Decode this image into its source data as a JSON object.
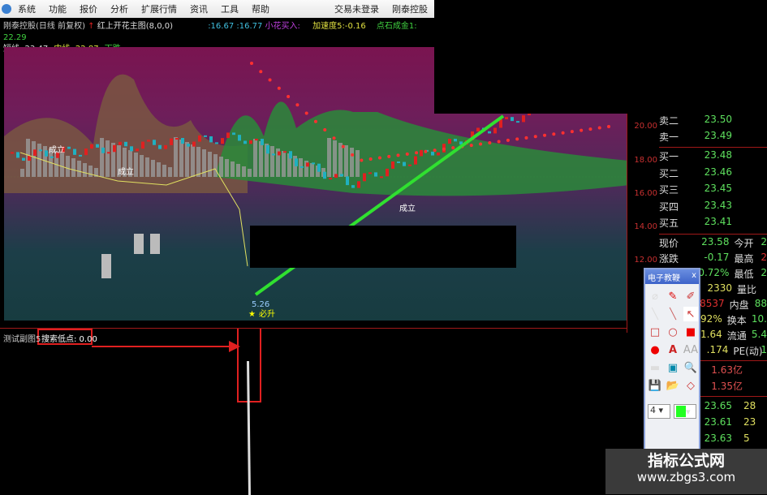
{
  "menu": {
    "items": [
      "系统",
      "功能",
      "报价",
      "分析",
      "扩展行情",
      "资讯",
      "工具",
      "帮助"
    ],
    "right": [
      "交易未登录",
      "刚泰控股"
    ]
  },
  "info": {
    "title": "刚泰控股(日线 前复权)",
    "formula": "红上开花主图(8,0,0)",
    "v1": ":16.67",
    ":v2": ":16.77",
    "v2": ":16.77",
    "xiaohua": "小花买入:",
    "accel": "加速度5:-0.16",
    "dianshi": "点石成金1: 22.29",
    "short": "短线: 23.47",
    "mid": "中线: 22.87",
    "fall": "下跌:-"
  },
  "axis": {
    "ticks": [
      "20.00",
      "18.00",
      "16.00",
      "14.00",
      "12.00"
    ]
  },
  "book": {
    "sell": [
      {
        "label": "卖二",
        "price": "23.50"
      },
      {
        "label": "卖一",
        "price": "23.49"
      }
    ],
    "buy": [
      {
        "label": "买一",
        "price": "23.48"
      },
      {
        "label": "买二",
        "price": "23.46"
      },
      {
        "label": "买三",
        "price": "23.45"
      },
      {
        "label": "买四",
        "price": "23.43"
      },
      {
        "label": "买五",
        "price": "23.41"
      }
    ],
    "stats": [
      {
        "l": "现价",
        "v": "23.58",
        "l2": "今开",
        "v2": "2"
      },
      {
        "l": "涨跌",
        "v": "-0.17",
        "l2": "最高",
        "v2": "2"
      },
      {
        "l": "涨幅",
        "v": "0.72%",
        "l2": "最低",
        "v2": "2"
      },
      {
        "l": "",
        "v": "2330",
        "l2": "量比",
        "v2": ""
      },
      {
        "l": "",
        "v": "8537",
        "l2": "内盘",
        "v2": "88"
      },
      {
        "l": "",
        "v": "92%",
        "l2": "换本",
        "v2": "10."
      },
      {
        "l": "",
        "v": "1.64",
        "l2": "流通",
        "v2": "5.4"
      },
      {
        "l": "",
        "v": ".174",
        "l2": "PE(动)",
        "v2": "1"
      }
    ],
    "money": [
      "1.63亿",
      "1.35亿"
    ],
    "ticks": [
      {
        "p": "23.65",
        "v": "28"
      },
      {
        "p": "23.61",
        "v": "23"
      },
      {
        "p": "23.63",
        "v": "5"
      }
    ]
  },
  "chart": {
    "labels": {
      "chengli1": "成立",
      "chengli2": "成立",
      "chengli3": "成立",
      "price": "5.26",
      "bisheng": "必升",
      "marker": "3"
    }
  },
  "sub": {
    "name": "测试副图5",
    "value": "搜索低点: 0.00"
  },
  "toolbox": {
    "title": "电子教鞭",
    "close": "x",
    "width": "4"
  },
  "watermark": {
    "line1": "指标公式网",
    "line2": "www.zbgs3.com"
  },
  "colors": {
    "up": "#e02020",
    "down": "#20b0c0",
    "trend": "#30e030",
    "gain": "#5ee05e"
  }
}
